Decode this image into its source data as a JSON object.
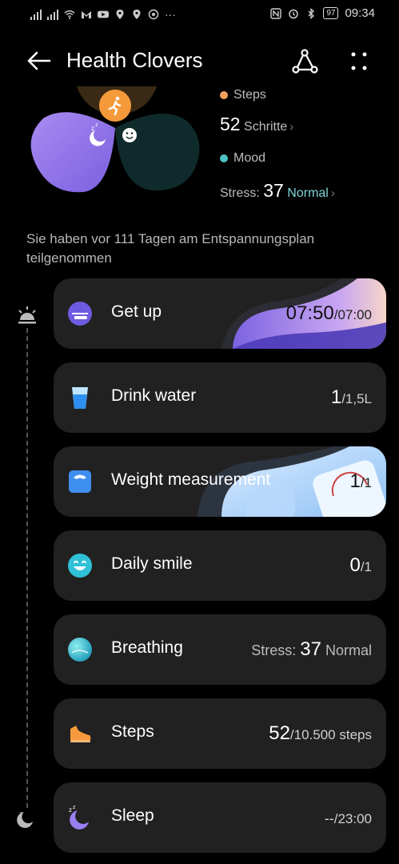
{
  "status_bar": {
    "time": "09:34",
    "battery": "97"
  },
  "header": {
    "title": "Health Clovers"
  },
  "summary": {
    "steps_label": "Steps",
    "steps_value": "52",
    "steps_unit": "Schritte",
    "mood_label": "Mood",
    "stress_label": "Stress:",
    "stress_value": "37",
    "stress_status": "Normal"
  },
  "plan_text": "Sie haben vor 111 Tagen am Entspannungsplan teilgenommen",
  "cards": [
    {
      "label": "Get up",
      "value": "07:50",
      "sub": "/07:00"
    },
    {
      "label": "Drink water",
      "value": "1",
      "sub": "/1,5L"
    },
    {
      "label": "Weight measurement",
      "value": "1",
      "sub": "/1"
    },
    {
      "label": "Daily smile",
      "value": "0",
      "sub": "/1"
    },
    {
      "label": "Breathing",
      "prefix": "Stress: ",
      "value": "37",
      "sub": " Normal"
    },
    {
      "label": "Steps",
      "value": "52",
      "sub": "/10.500 steps"
    },
    {
      "label": "Sleep",
      "value": "--",
      "sub": "/23:00"
    }
  ],
  "colors": {
    "steps_dot": "#f5a25d",
    "mood_dot": "#4fc3c7",
    "stress_status": "#7fd3d6",
    "card_bg": "#212121"
  }
}
